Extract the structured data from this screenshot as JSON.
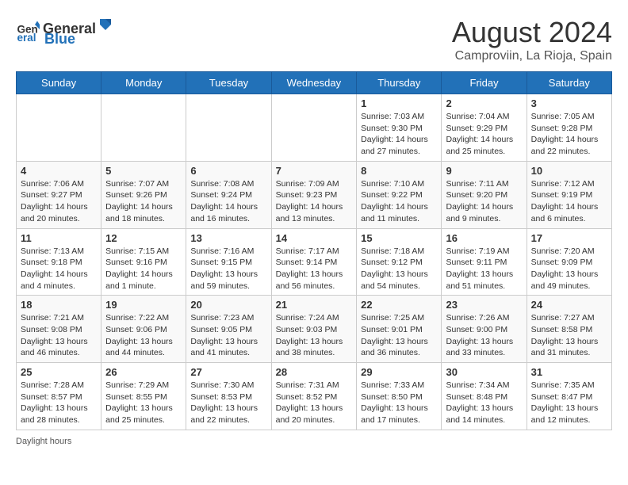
{
  "header": {
    "logo_general": "General",
    "logo_blue": "Blue",
    "month_year": "August 2024",
    "location": "Camproviin, La Rioja, Spain"
  },
  "calendar": {
    "days_of_week": [
      "Sunday",
      "Monday",
      "Tuesday",
      "Wednesday",
      "Thursday",
      "Friday",
      "Saturday"
    ],
    "weeks": [
      [
        {
          "day": "",
          "info": ""
        },
        {
          "day": "",
          "info": ""
        },
        {
          "day": "",
          "info": ""
        },
        {
          "day": "",
          "info": ""
        },
        {
          "day": "1",
          "info": "Sunrise: 7:03 AM\nSunset: 9:30 PM\nDaylight: 14 hours and 27 minutes."
        },
        {
          "day": "2",
          "info": "Sunrise: 7:04 AM\nSunset: 9:29 PM\nDaylight: 14 hours and 25 minutes."
        },
        {
          "day": "3",
          "info": "Sunrise: 7:05 AM\nSunset: 9:28 PM\nDaylight: 14 hours and 22 minutes."
        }
      ],
      [
        {
          "day": "4",
          "info": "Sunrise: 7:06 AM\nSunset: 9:27 PM\nDaylight: 14 hours and 20 minutes."
        },
        {
          "day": "5",
          "info": "Sunrise: 7:07 AM\nSunset: 9:26 PM\nDaylight: 14 hours and 18 minutes."
        },
        {
          "day": "6",
          "info": "Sunrise: 7:08 AM\nSunset: 9:24 PM\nDaylight: 14 hours and 16 minutes."
        },
        {
          "day": "7",
          "info": "Sunrise: 7:09 AM\nSunset: 9:23 PM\nDaylight: 14 hours and 13 minutes."
        },
        {
          "day": "8",
          "info": "Sunrise: 7:10 AM\nSunset: 9:22 PM\nDaylight: 14 hours and 11 minutes."
        },
        {
          "day": "9",
          "info": "Sunrise: 7:11 AM\nSunset: 9:20 PM\nDaylight: 14 hours and 9 minutes."
        },
        {
          "day": "10",
          "info": "Sunrise: 7:12 AM\nSunset: 9:19 PM\nDaylight: 14 hours and 6 minutes."
        }
      ],
      [
        {
          "day": "11",
          "info": "Sunrise: 7:13 AM\nSunset: 9:18 PM\nDaylight: 14 hours and 4 minutes."
        },
        {
          "day": "12",
          "info": "Sunrise: 7:15 AM\nSunset: 9:16 PM\nDaylight: 14 hours and 1 minute."
        },
        {
          "day": "13",
          "info": "Sunrise: 7:16 AM\nSunset: 9:15 PM\nDaylight: 13 hours and 59 minutes."
        },
        {
          "day": "14",
          "info": "Sunrise: 7:17 AM\nSunset: 9:14 PM\nDaylight: 13 hours and 56 minutes."
        },
        {
          "day": "15",
          "info": "Sunrise: 7:18 AM\nSunset: 9:12 PM\nDaylight: 13 hours and 54 minutes."
        },
        {
          "day": "16",
          "info": "Sunrise: 7:19 AM\nSunset: 9:11 PM\nDaylight: 13 hours and 51 minutes."
        },
        {
          "day": "17",
          "info": "Sunrise: 7:20 AM\nSunset: 9:09 PM\nDaylight: 13 hours and 49 minutes."
        }
      ],
      [
        {
          "day": "18",
          "info": "Sunrise: 7:21 AM\nSunset: 9:08 PM\nDaylight: 13 hours and 46 minutes."
        },
        {
          "day": "19",
          "info": "Sunrise: 7:22 AM\nSunset: 9:06 PM\nDaylight: 13 hours and 44 minutes."
        },
        {
          "day": "20",
          "info": "Sunrise: 7:23 AM\nSunset: 9:05 PM\nDaylight: 13 hours and 41 minutes."
        },
        {
          "day": "21",
          "info": "Sunrise: 7:24 AM\nSunset: 9:03 PM\nDaylight: 13 hours and 38 minutes."
        },
        {
          "day": "22",
          "info": "Sunrise: 7:25 AM\nSunset: 9:01 PM\nDaylight: 13 hours and 36 minutes."
        },
        {
          "day": "23",
          "info": "Sunrise: 7:26 AM\nSunset: 9:00 PM\nDaylight: 13 hours and 33 minutes."
        },
        {
          "day": "24",
          "info": "Sunrise: 7:27 AM\nSunset: 8:58 PM\nDaylight: 13 hours and 31 minutes."
        }
      ],
      [
        {
          "day": "25",
          "info": "Sunrise: 7:28 AM\nSunset: 8:57 PM\nDaylight: 13 hours and 28 minutes."
        },
        {
          "day": "26",
          "info": "Sunrise: 7:29 AM\nSunset: 8:55 PM\nDaylight: 13 hours and 25 minutes."
        },
        {
          "day": "27",
          "info": "Sunrise: 7:30 AM\nSunset: 8:53 PM\nDaylight: 13 hours and 22 minutes."
        },
        {
          "day": "28",
          "info": "Sunrise: 7:31 AM\nSunset: 8:52 PM\nDaylight: 13 hours and 20 minutes."
        },
        {
          "day": "29",
          "info": "Sunrise: 7:33 AM\nSunset: 8:50 PM\nDaylight: 13 hours and 17 minutes."
        },
        {
          "day": "30",
          "info": "Sunrise: 7:34 AM\nSunset: 8:48 PM\nDaylight: 13 hours and 14 minutes."
        },
        {
          "day": "31",
          "info": "Sunrise: 7:35 AM\nSunset: 8:47 PM\nDaylight: 13 hours and 12 minutes."
        }
      ]
    ]
  },
  "footer": {
    "daylight_label": "Daylight hours"
  }
}
